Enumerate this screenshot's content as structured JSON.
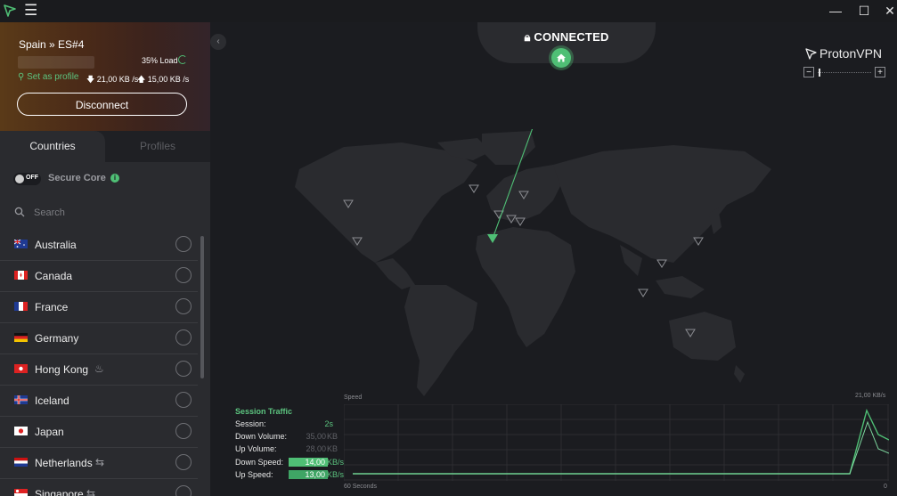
{
  "titlebar": {
    "menu_glyph": "☰",
    "minimize": "—",
    "maximize": "☐",
    "close": "✕"
  },
  "connection": {
    "server": "Spain » ES#4",
    "load": "35% Load",
    "set_profile": "Set as profile",
    "down_rate": "21,00 KB /s",
    "up_rate": "15,00 KB /s",
    "disconnect_label": "Disconnect"
  },
  "tabs": {
    "countries": "Countries",
    "profiles": "Profiles"
  },
  "secure_core": {
    "toggle_state": "OFF",
    "label": "Secure Core",
    "info": "i"
  },
  "search": {
    "placeholder": "Search"
  },
  "countries": [
    {
      "name": "Australia",
      "feature": ""
    },
    {
      "name": "Canada",
      "feature": ""
    },
    {
      "name": "France",
      "feature": ""
    },
    {
      "name": "Germany",
      "feature": ""
    },
    {
      "name": "Hong Kong",
      "feature": "tor-icon"
    },
    {
      "name": "Iceland",
      "feature": ""
    },
    {
      "name": "Japan",
      "feature": ""
    },
    {
      "name": "Netherlands",
      "feature": "p2p-icon"
    },
    {
      "name": "Singapore",
      "feature": "p2p-icon"
    }
  ],
  "status": {
    "text": "CONNECTED"
  },
  "brand": {
    "name": "ProtonVPN"
  },
  "zoom": {
    "minus": "−",
    "plus": "+"
  },
  "traffic": {
    "title": "Session Traffic",
    "session_label": "Session:",
    "session_value": "2s",
    "down_volume_label": "Down Volume:",
    "down_volume_value": "35,00",
    "down_volume_unit": "KB",
    "up_volume_label": "Up Volume:",
    "up_volume_value": "28,00",
    "up_volume_unit": "KB",
    "down_speed_label": "Down Speed:",
    "down_speed_value": "14,00",
    "down_speed_unit": "KB/s",
    "up_speed_label": "Up Speed:",
    "up_speed_value": "13,00",
    "up_speed_unit": "KB/s",
    "graph_title": "Speed",
    "graph_max": "21,00  KB/s",
    "graph_left": "60 Seconds",
    "graph_right": "0"
  },
  "colors": {
    "accent": "#4fbf75",
    "background": "#1b1c20",
    "sidebar": "#2a2b2f"
  }
}
